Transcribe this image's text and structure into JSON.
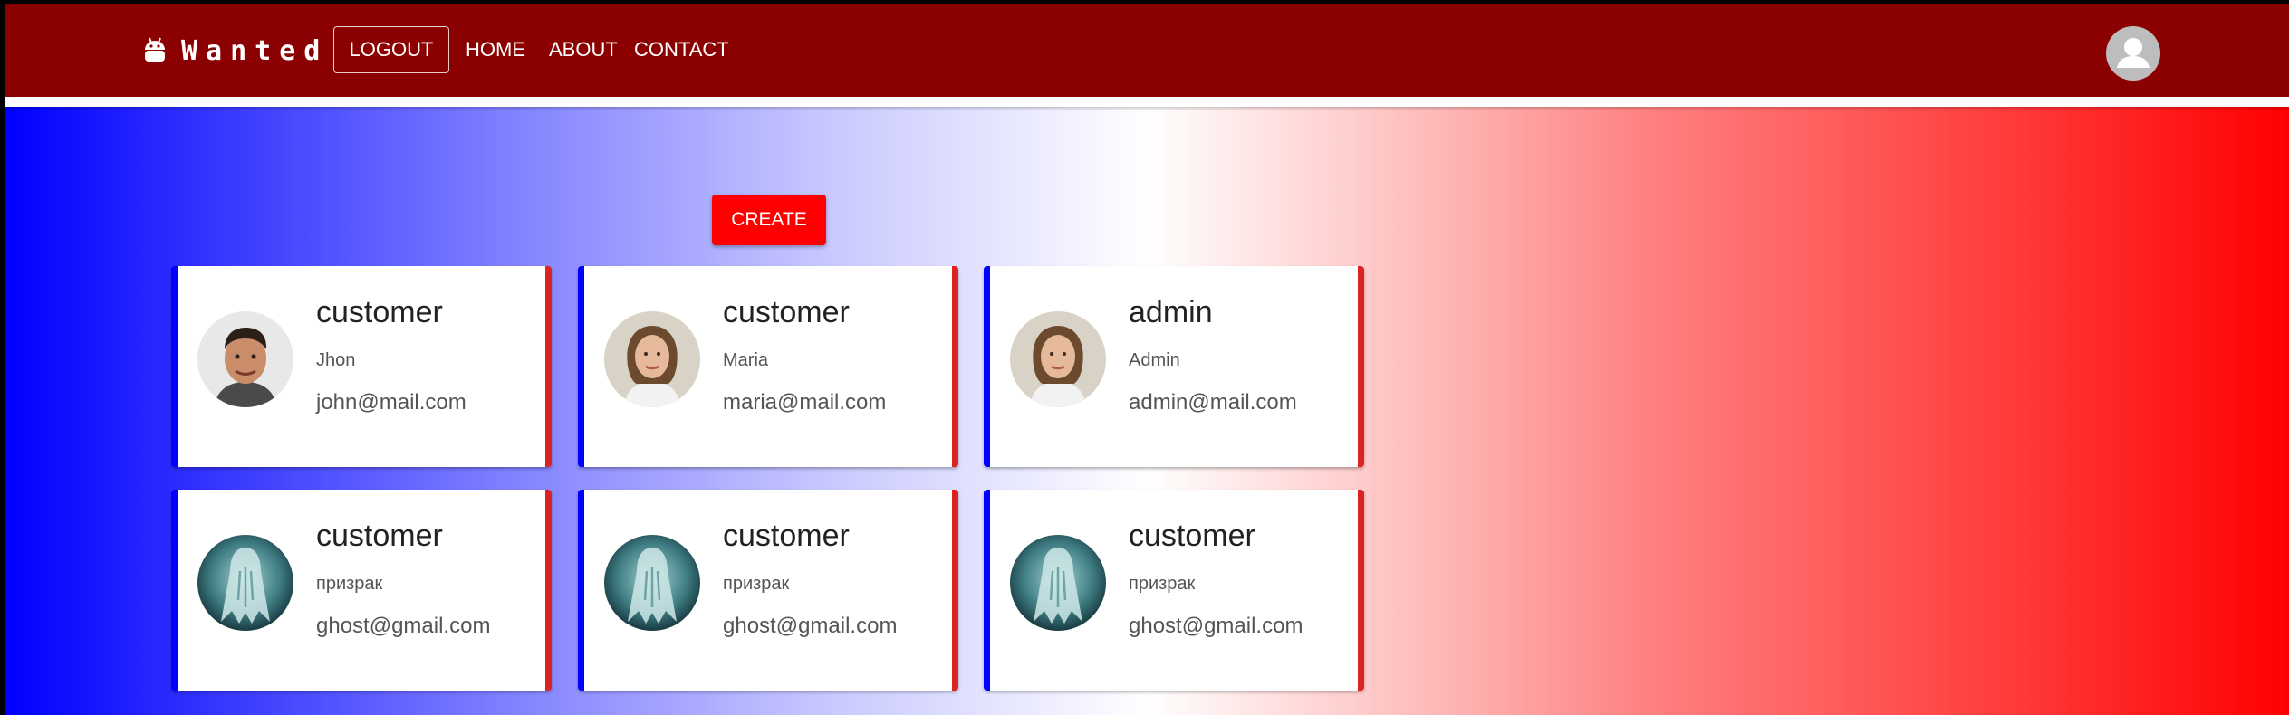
{
  "header": {
    "brand": "Wanted",
    "nav": {
      "logout": "LOGOUT",
      "home": "HOME",
      "about": "ABOUT",
      "contact": "CONTACT"
    },
    "bar_color": "#8b0000"
  },
  "actions": {
    "create": "CREATE",
    "create_color": "#ff0000"
  },
  "cards": [
    {
      "role": "customer",
      "name": "Jhon",
      "email": "john@mail.com",
      "avatar": "man-photo"
    },
    {
      "role": "customer",
      "name": "Maria",
      "email": "maria@mail.com",
      "avatar": "woman-photo"
    },
    {
      "role": "admin",
      "name": "Admin",
      "email": "admin@mail.com",
      "avatar": "woman-photo"
    },
    {
      "role": "customer",
      "name": "призрак",
      "email": "ghost@gmail.com",
      "avatar": "ghost-photo"
    },
    {
      "role": "customer",
      "name": "призрак",
      "email": "ghost@gmail.com",
      "avatar": "ghost-photo"
    },
    {
      "role": "customer",
      "name": "призрак",
      "email": "ghost@gmail.com",
      "avatar": "ghost-photo"
    }
  ],
  "theme": {
    "card_left_border": "#0000ff",
    "card_right_border": "#dd2222",
    "gradient_left": "#0000ff",
    "gradient_right": "#ff0000"
  }
}
